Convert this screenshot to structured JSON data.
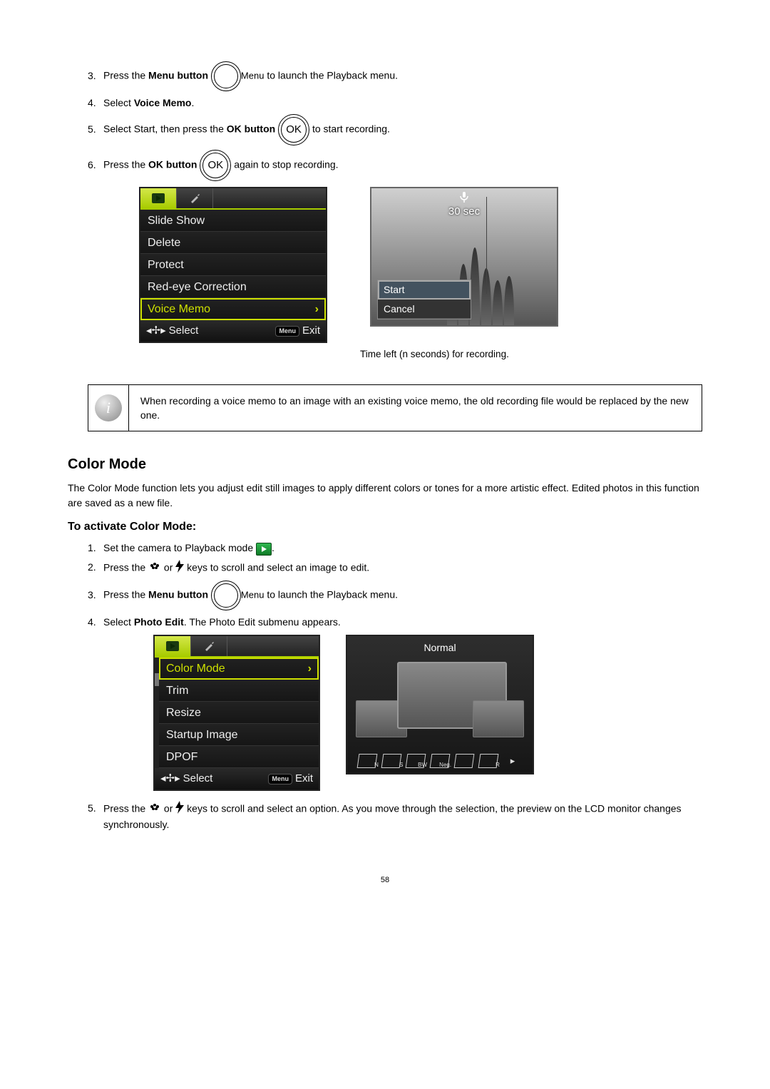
{
  "steps_a": {
    "s3_num": "3.",
    "s3_a": "Press the ",
    "s3_b": "Menu button",
    "s3_menu_label": "Menu",
    "s3_c": " to launch the Playback menu.",
    "s4_num": "4.",
    "s4_a": "Select ",
    "s4_b": "Voice Memo",
    "s4_c": ".",
    "s5_num": "5.",
    "s5_a": "Select Start, then press the ",
    "s5_b": "OK button",
    "s5_ok": "OK",
    "s5_c": " to start recording.",
    "s6_num": "6.",
    "s6_a": "Press the ",
    "s6_b": "OK button",
    "s6_ok": "OK",
    "s6_c": " again to stop recording."
  },
  "menu1": {
    "items": {
      "i0": "Slide Show",
      "i1": "Delete",
      "i2": "Protect",
      "i3": "Red-eye Correction",
      "i4": "Voice Memo"
    },
    "footer_select": "Select",
    "footer_menu": "Menu",
    "footer_exit": "Exit"
  },
  "preview1": {
    "timer": "30 sec",
    "popup_start": "Start",
    "popup_cancel": "Cancel"
  },
  "caption1": "Time left (n seconds) for recording.",
  "note": "When recording a voice memo to an image with an existing voice memo, the old recording file would be replaced by the new one.",
  "section_title": "Color Mode",
  "section_para": "The Color Mode function lets you adjust edit still images to apply different colors or tones for a more artistic effect. Edited photos in this function are saved as a new file.",
  "subheading": "To activate Color Mode:",
  "steps_b": {
    "s1_num": "1.",
    "s1_a": "Set the camera to Playback mode ",
    "s1_b": ".",
    "s2_num": "2.",
    "s2_a": "Press the ",
    "s2_b": " or ",
    "s2_c": " keys to scroll and select an image to edit.",
    "s3_num": "3.",
    "s3_a": "Press the ",
    "s3_b": "Menu button",
    "s3_menu_label": "Menu",
    "s3_c": " to launch the Playback menu.",
    "s4_num": "4.",
    "s4_a": "Select ",
    "s4_b": "Photo Edit",
    "s4_c": ". The Photo Edit submenu appears."
  },
  "menu2": {
    "items": {
      "i0": "Color Mode",
      "i1": "Trim",
      "i2": "Resize",
      "i3": "Startup Image",
      "i4": "DPOF"
    },
    "footer_select": "Select",
    "footer_menu": "Menu",
    "footer_exit": "Exit"
  },
  "preview2": {
    "title": "Normal",
    "modes": {
      "m0": "N",
      "m1": "S",
      "m2": "BW",
      "m3": "Neg.",
      "m4": "",
      "m5": "R"
    }
  },
  "steps_c": {
    "s5_num": "5.",
    "s5_a": "Press the ",
    "s5_b": " or ",
    "s5_c": " keys to scroll and select an option. As you move through the selection, the preview on the LCD monitor changes synchronously."
  },
  "page_number": "58"
}
